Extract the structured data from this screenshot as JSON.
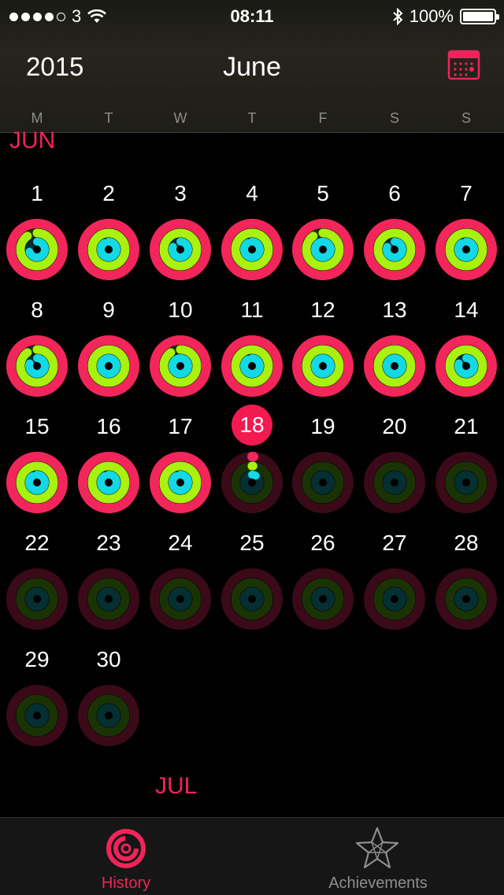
{
  "status_bar": {
    "carrier": "3",
    "time": "08:11",
    "battery": "100%"
  },
  "header": {
    "year": "2015",
    "month": "June"
  },
  "weekdays": [
    "M",
    "T",
    "W",
    "T",
    "F",
    "S",
    "S"
  ],
  "sections": {
    "current": "JUN",
    "next": "JUL"
  },
  "today": 18,
  "colors": {
    "move": "#f2265b",
    "exercise": "#a9f10e",
    "stand": "#13d8e6",
    "accent": "#f0245a"
  },
  "days": [
    {
      "label": "1",
      "move": 1.0,
      "exercise": 0.9,
      "stand": 0.7
    },
    {
      "label": "2",
      "move": 1.0,
      "exercise": 1.0,
      "stand": 0.9
    },
    {
      "label": "3",
      "move": 1.0,
      "exercise": 1.0,
      "stand": 0.8
    },
    {
      "label": "4",
      "move": 1.0,
      "exercise": 1.0,
      "stand": 0.9
    },
    {
      "label": "5",
      "move": 1.0,
      "exercise": 0.9,
      "stand": 1.0
    },
    {
      "label": "6",
      "move": 1.0,
      "exercise": 1.0,
      "stand": 0.8
    },
    {
      "label": "7",
      "move": 1.0,
      "exercise": 1.0,
      "stand": 0.9
    },
    {
      "label": "8",
      "move": 1.0,
      "exercise": 0.9,
      "stand": 0.8
    },
    {
      "label": "9",
      "move": 1.0,
      "exercise": 1.0,
      "stand": 1.0
    },
    {
      "label": "10",
      "move": 1.0,
      "exercise": 0.9,
      "stand": 1.0
    },
    {
      "label": "11",
      "move": 1.0,
      "exercise": 1.0,
      "stand": 0.9
    },
    {
      "label": "12",
      "move": 1.0,
      "exercise": 1.0,
      "stand": 1.0
    },
    {
      "label": "13",
      "move": 1.0,
      "exercise": 1.0,
      "stand": 1.0
    },
    {
      "label": "14",
      "move": 1.0,
      "exercise": 1.0,
      "stand": 0.8
    },
    {
      "label": "15",
      "move": 1.0,
      "exercise": 1.0,
      "stand": 0.9
    },
    {
      "label": "16",
      "move": 1.0,
      "exercise": 1.0,
      "stand": 0.9
    },
    {
      "label": "17",
      "move": 1.0,
      "exercise": 1.0,
      "stand": 0.9
    },
    {
      "label": "18",
      "move": 0.01,
      "exercise": 0.01,
      "stand": 0.08
    },
    {
      "label": "19",
      "move": 0,
      "exercise": 0,
      "stand": 0
    },
    {
      "label": "20",
      "move": 0,
      "exercise": 0,
      "stand": 0
    },
    {
      "label": "21",
      "move": 0,
      "exercise": 0,
      "stand": 0
    },
    {
      "label": "22",
      "move": 0,
      "exercise": 0,
      "stand": 0
    },
    {
      "label": "23",
      "move": 0,
      "exercise": 0,
      "stand": 0
    },
    {
      "label": "24",
      "move": 0,
      "exercise": 0,
      "stand": 0
    },
    {
      "label": "25",
      "move": 0,
      "exercise": 0,
      "stand": 0
    },
    {
      "label": "26",
      "move": 0,
      "exercise": 0,
      "stand": 0
    },
    {
      "label": "27",
      "move": 0,
      "exercise": 0,
      "stand": 0
    },
    {
      "label": "28",
      "move": 0,
      "exercise": 0,
      "stand": 0
    },
    {
      "label": "29",
      "move": 0,
      "exercise": 0,
      "stand": 0
    },
    {
      "label": "30",
      "move": 0,
      "exercise": 0,
      "stand": 0
    }
  ],
  "tabs": [
    {
      "label": "History",
      "icon": "activity-rings-icon",
      "active": true
    },
    {
      "label": "Achievements",
      "icon": "star-icon",
      "active": false
    }
  ]
}
